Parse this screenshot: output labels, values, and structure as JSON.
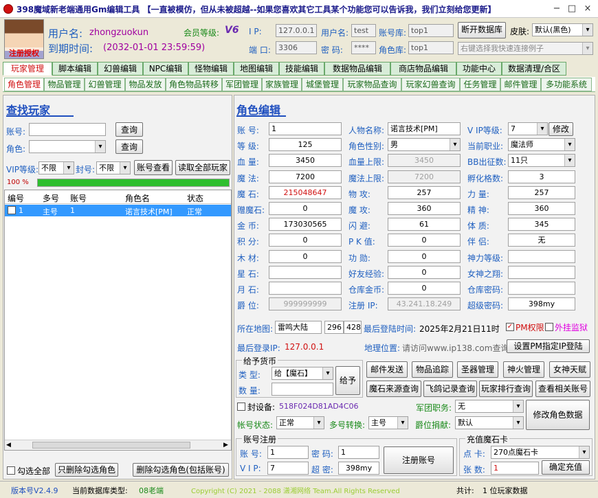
{
  "window": {
    "title": "398魔域新老端通用Gm编辑工具 【一直被模仿，但从未被超越--如果您喜欢其它工具某个功能您可以告诉我，我们立刻给您更新】",
    "min": "−",
    "max": "□",
    "close": "×"
  },
  "user": {
    "avatar_caption": "注册授权",
    "name_label": "用户名:",
    "name": "zhongzuokun",
    "expiry_label": "到期时间:",
    "expiry": "(2032-01-01 23:59:59)",
    "member_label": "会员等级:",
    "member_level": "V6"
  },
  "conn": {
    "ip_label": "I  P:",
    "ip": "127.0.0.1",
    "port_label": "端 口:",
    "port": "3306",
    "user_label": "用户名:",
    "user": "test",
    "pass_label": "密  码:",
    "pass": "****",
    "acct_db_label": "账号库:",
    "acct_db": "top1",
    "role_db_label": "角色库:",
    "role_db": "top1",
    "disconnect": "断开数据库",
    "skin_label": "皮肤:",
    "skin": "默认(黑色)",
    "quick_connect": "右键选择我快速连接例子"
  },
  "main_tabs": [
    "玩家管理",
    "脚本编辑",
    "幻兽编辑",
    "NPC编辑",
    "怪物编辑",
    "地图编辑",
    "技能编辑",
    "数据物品编辑",
    "商店物品编辑",
    "功能中心",
    "数据清理/合区"
  ],
  "sub_tabs": [
    "角色管理",
    "物品管理",
    "幻兽管理",
    "物品发放",
    "角色物品转移",
    "军团管理",
    "家族管理",
    "城堡管理",
    "玩家物品查询",
    "玩家幻兽查询",
    "任务管理",
    "邮件管理",
    "多功能系统"
  ],
  "find": {
    "title": "查找玩家",
    "acct_label": "账号:",
    "role_label": "角色:",
    "query": "查询",
    "vip_label": "VIP等级:",
    "vip": "不限",
    "ban_label": "封号:",
    "ban": "不限",
    "acct_view": "账号查看",
    "read_all": "读取全部玩家",
    "progress_text": "100 %",
    "progress": 1.0
  },
  "grid": {
    "headers": [
      "编号",
      "多号",
      "账号",
      "角色名",
      "状态"
    ],
    "rows": [
      [
        "1",
        "主号",
        "1",
        "诺言技术[PM]",
        "正常"
      ]
    ],
    "check_all": "勾选全部",
    "del_checked_role": "只删除勾选角色",
    "del_checked_all": "删除勾选角色(包括账号)"
  },
  "edit": {
    "title": "角色编辑",
    "col1": [
      {
        "l": "账  号:",
        "v": "1"
      },
      {
        "l": "等  级:",
        "v": "125"
      },
      {
        "l": "血  量:",
        "v": "3450"
      },
      {
        "l": "魔  法:",
        "v": "7200"
      },
      {
        "l": "魔  石:",
        "v": "215048647"
      },
      {
        "l": "赠魔石:",
        "v": "0"
      },
      {
        "l": "金  币:",
        "v": "173030565"
      },
      {
        "l": "积  分:",
        "v": "0"
      },
      {
        "l": "木  材:",
        "v": "0"
      },
      {
        "l": "星  石:",
        "v": ""
      },
      {
        "l": "月  石:",
        "v": ""
      },
      {
        "l": "爵  位:",
        "v": "999999999"
      }
    ],
    "col2": [
      {
        "l": "人物名称:",
        "v": "诺言技术[PM]"
      },
      {
        "l": "角色性别:",
        "v": "男"
      },
      {
        "l": "血量上限:",
        "v": "3450"
      },
      {
        "l": "魔法上限:",
        "v": "7200"
      },
      {
        "l": "物  攻:",
        "v": "257"
      },
      {
        "l": "魔  攻:",
        "v": "360"
      },
      {
        "l": "闪  避:",
        "v": "61"
      },
      {
        "l": "P K 值:",
        "v": "0"
      },
      {
        "l": "功  勋:",
        "v": "0"
      },
      {
        "l": "好友经验:",
        "v": "0"
      },
      {
        "l": "仓库金币:",
        "v": "0"
      },
      {
        "l": "注册  IP:",
        "v": "43.241.18.249"
      }
    ],
    "col3": [
      {
        "l": "V IP等级:",
        "v": "7"
      },
      {
        "l": "当前职业:",
        "v": "魔法师"
      },
      {
        "l": "BB出征数:",
        "v": "11只"
      },
      {
        "l": "孵化格数:",
        "v": "3"
      },
      {
        "l": "力  量:",
        "v": "257"
      },
      {
        "l": "精  神:",
        "v": "360"
      },
      {
        "l": "体  质:",
        "v": "345"
      },
      {
        "l": "伴  侣:",
        "v": "无"
      },
      {
        "l": "神力等级:",
        "v": ""
      },
      {
        "l": "女神之翔:",
        "v": ""
      },
      {
        "l": "仓库密码:",
        "v": ""
      },
      {
        "l": "超级密码:",
        "v": "398my"
      }
    ],
    "modify": "修改",
    "map_label": "所在地图:",
    "map": "雷鸣大陆",
    "map_x": "296",
    "map_y": "428",
    "last_time_label": "最后登陆时间:",
    "last_time": "2025年2月21日11时",
    "pm_label": "PM权限",
    "plugin_label": "外挂监狱",
    "last_ip_label": "最后登录IP:",
    "last_ip": "127.0.0.1",
    "geo_label": "地理位置:",
    "geo": "请访问www.ip138.com查询",
    "set_pm_ip": "设置PM指定IP登陆"
  },
  "currency": {
    "title": "给予货币",
    "type_label": "类  型:",
    "type": "给【魔石】",
    "qty_label": "数  量:",
    "give": "给予"
  },
  "actions": [
    "邮件发送",
    "物品追踪",
    "圣器管理",
    "神火管理",
    "女神天赋",
    "魔石来源查询",
    "飞鸽记录查询",
    "玩家排行查询",
    "查看相关账号"
  ],
  "device": {
    "label": "封设备:",
    "value": "518F024D81AD4C06",
    "corps_label": "军团职务:",
    "corps": "无"
  },
  "acct_state": {
    "label": "帐号状态:",
    "value": "正常",
    "multi_label": "多号转换:",
    "multi": "主号",
    "donate_label": "爵位捐献:",
    "donate": "默认",
    "save": "修改角色数据"
  },
  "reg": {
    "title": "账号注册",
    "acct_label": "账  号:",
    "acct": "1",
    "pwd_label": "密  码:",
    "pwd": "1",
    "vip_label": "V I P:",
    "vip": "7",
    "super_label": "超  密:",
    "super": "398my",
    "submit": "注册账号"
  },
  "recharge": {
    "title": "充值魔石卡",
    "card_label": "点  卡:",
    "card": "270点魔石卡",
    "count_label": "张  数:",
    "count": "1",
    "confirm": "确定充值"
  },
  "status": {
    "version": "版本号V2.4.9",
    "db_type_label": "当前数据库类型:",
    "db_type": "08老端",
    "copyright": "Copyright (C) 2021 - 2088 潇湘网络 Team.All Rights Reserved",
    "total_label": "共计:",
    "total": "1 位玩家数据"
  }
}
